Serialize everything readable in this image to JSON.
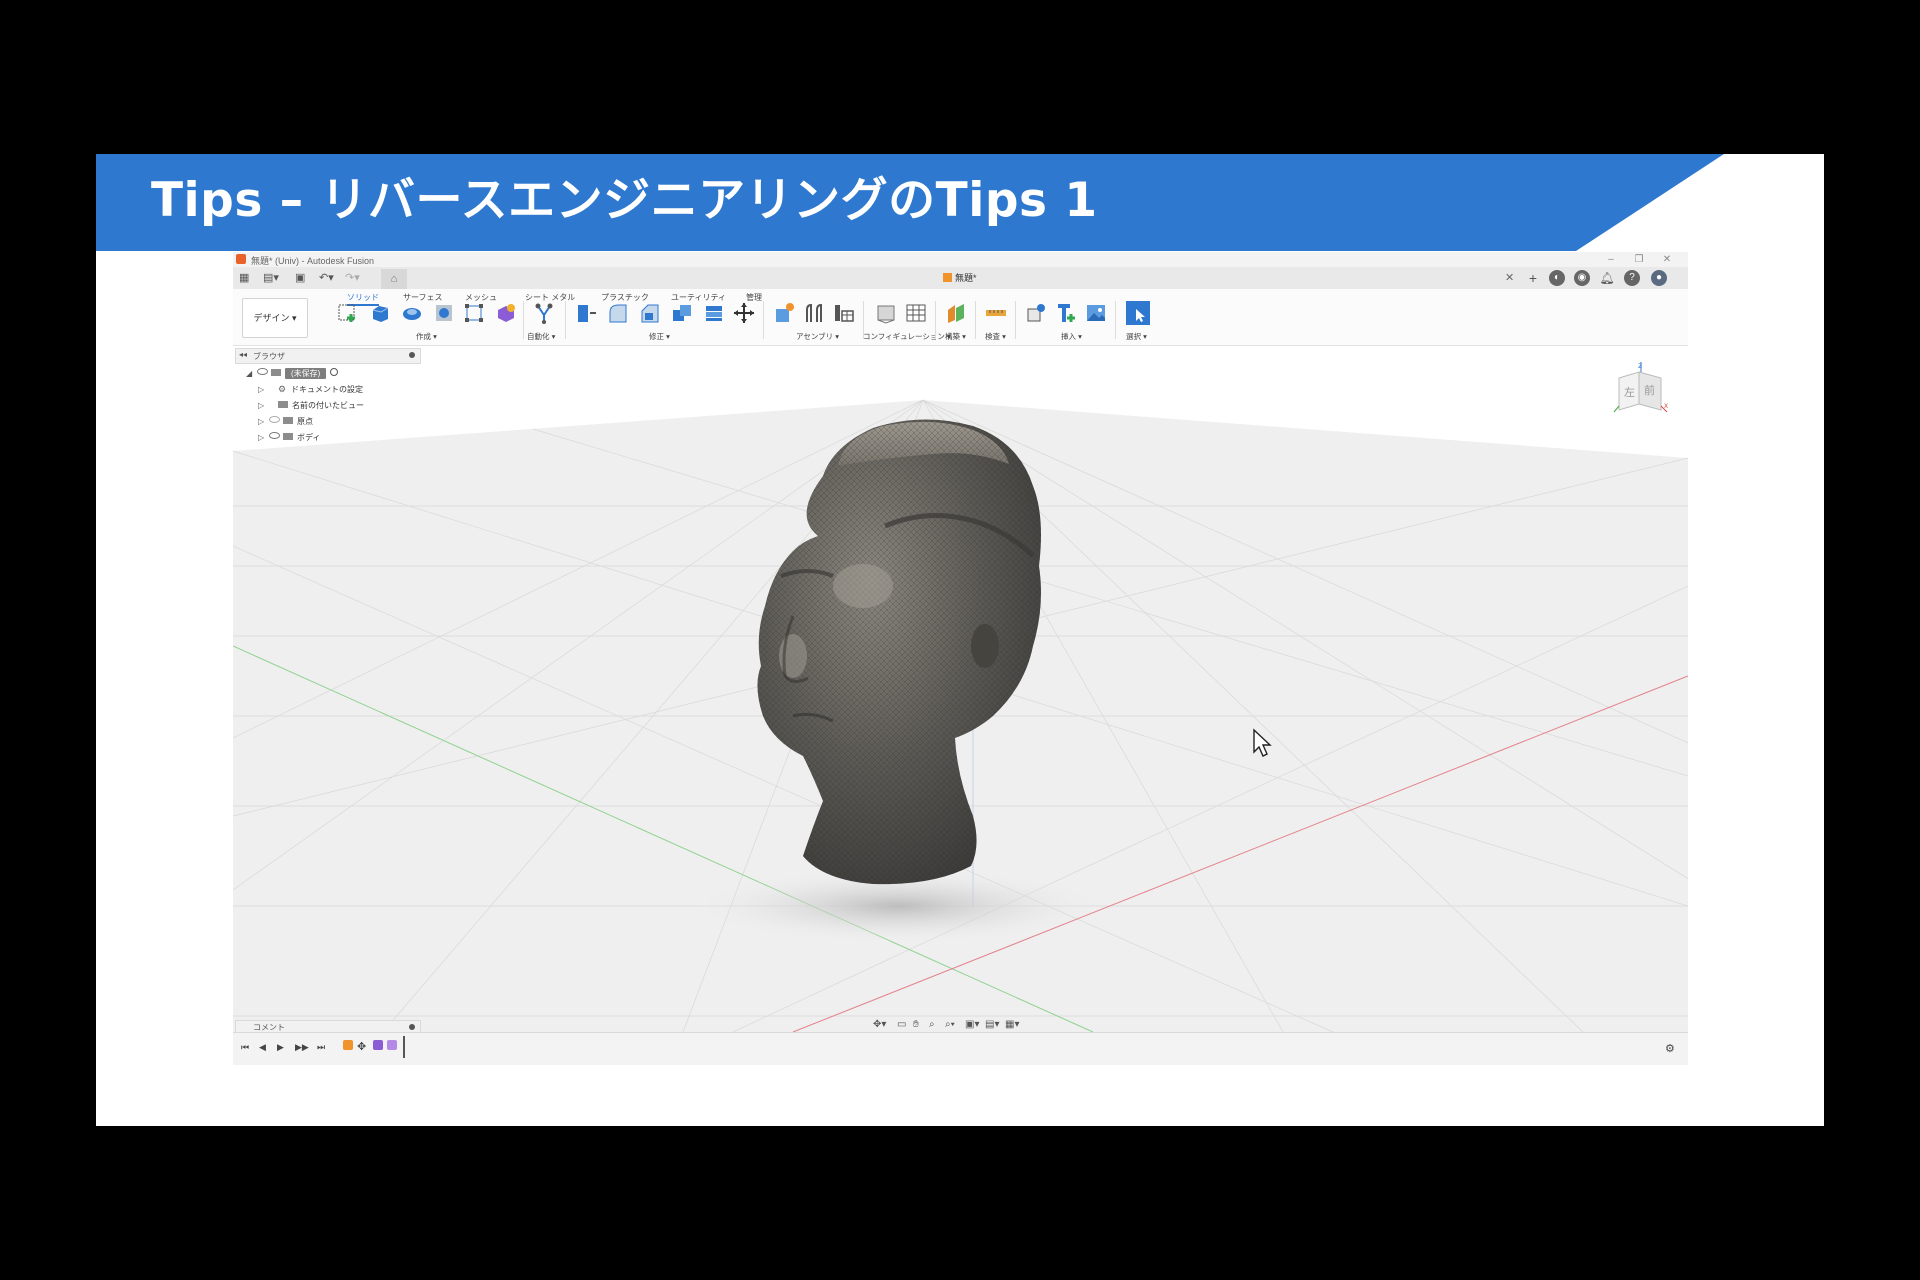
{
  "slide": {
    "title": "Tips – リバースエンジニアリングのTips 1",
    "banner_color": "#2e78cf"
  },
  "window": {
    "title": "無題* (Univ) - Autodesk Fusion",
    "controls": [
      "–",
      "❐",
      "✕"
    ]
  },
  "tabbar": {
    "document_tab": "無題*",
    "close": "✕"
  },
  "toolbar": {
    "workspace": "デザイン ▾",
    "tabs": [
      "ソリッド",
      "サーフェス",
      "メッシュ",
      "シート メタル",
      "プラスチック",
      "ユーティリティ",
      "管理"
    ],
    "active_tab": 0,
    "groups": [
      "作成 ▾",
      "自動化 ▾",
      "修正 ▾",
      "アセンブリ ▾",
      "コンフィギュレーション ▾",
      "構築 ▾",
      "検査 ▾",
      "挿入 ▾",
      "選択 ▾"
    ]
  },
  "browser": {
    "label": "ブラウザ",
    "collapse": "◂◂",
    "root": "(未保存)",
    "items": [
      "ドキュメントの設定",
      "名前の付いたビュー",
      "原点",
      "ボディ"
    ]
  },
  "viewcube": {
    "left_face": "左",
    "front_face": "前",
    "z_label": "Z",
    "x_label": "X"
  },
  "comment": {
    "label": "コメント"
  },
  "icons": {
    "nav": [
      "orbit-icon",
      "look-at-icon",
      "pan-icon",
      "zoom-window-icon",
      "zoom-icon",
      "display-settings-icon",
      "visual-style-icon",
      "grid-icon"
    ],
    "timeline": [
      "first-icon",
      "prev-icon",
      "play-icon",
      "next-icon",
      "last-icon"
    ]
  },
  "colors": {
    "accent": "#2e78cf",
    "mesh": "#5e5b56"
  }
}
